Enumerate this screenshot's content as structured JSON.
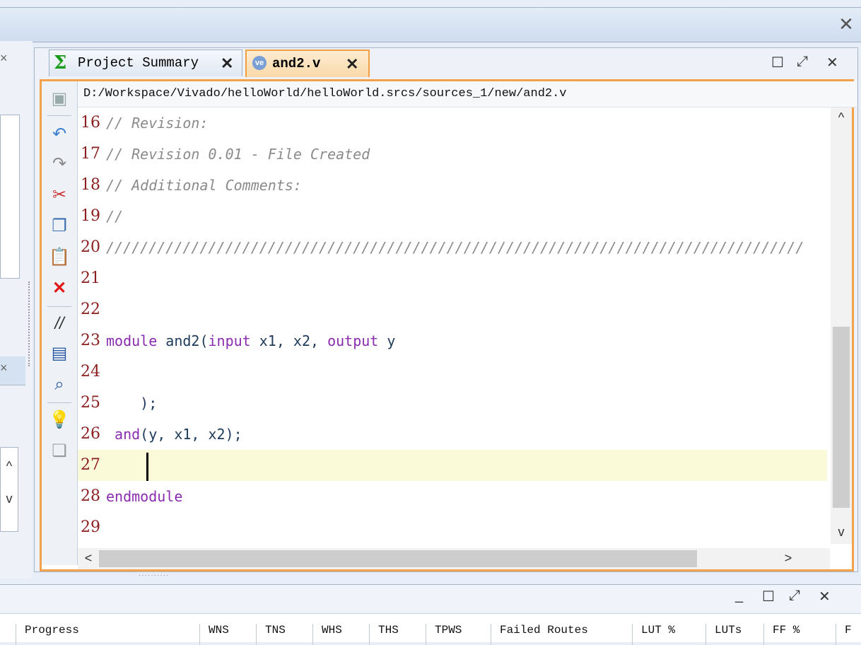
{
  "top_window": {
    "close_label": "✕"
  },
  "left_panels": {
    "close_label": "×",
    "scroll_up": "^",
    "scroll_down": "v"
  },
  "editor": {
    "tabs": [
      {
        "label": "Project Summary",
        "icon": "sigma-icon",
        "close_label": "✕"
      },
      {
        "label": "and2.v",
        "icon": "verilog-file-icon",
        "close_label": "✕",
        "active": true
      }
    ],
    "window_controls": {
      "maximize": "☐",
      "restore": "⤢",
      "close": "✕"
    },
    "file_path": "D:/Workspace/Vivado/helloWorld/helloWorld.srcs/sources_1/new/and2.v",
    "lines": [
      {
        "num": "16",
        "text": "// Revision:"
      },
      {
        "num": "17",
        "text": "// Revision 0.01 - File Created"
      },
      {
        "num": "18",
        "text": "// Additional Comments:"
      },
      {
        "num": "19",
        "text": "//"
      },
      {
        "num": "20",
        "text": "//////////////////////////////////////////////////////////////////////////////////"
      },
      {
        "num": "21",
        "text": ""
      },
      {
        "num": "22",
        "text": ""
      },
      {
        "num": "23",
        "p1": "module",
        "p2": " and2(",
        "p3": "input",
        "p4": " x1, x2, ",
        "p5": "output",
        "p6": " y"
      },
      {
        "num": "24",
        "text": ""
      },
      {
        "num": "25",
        "text": "    );"
      },
      {
        "num": "26",
        "p1": " and",
        "p2": "(y, x1, x2);"
      },
      {
        "num": "27",
        "text": ""
      },
      {
        "num": "28",
        "text": "endmodule"
      },
      {
        "num": "29",
        "text": ""
      }
    ],
    "scroll": {
      "up": "^",
      "down": "v",
      "left": "<",
      "right": ">"
    },
    "colors": {
      "accent": "#f4a24a",
      "comment": "#8a8a8a",
      "keyword": "#8a2caf",
      "line_number": "#8b1e1e",
      "current_line": "#fbfad8"
    }
  },
  "bottom_panel": {
    "controls": {
      "minimize": "_",
      "maximize": "☐",
      "restore": "⤢",
      "close": "✕"
    },
    "columns": [
      "Progress",
      "WNS",
      "TNS",
      "WHS",
      "THS",
      "TPWS",
      "Failed Routes",
      "LUT %",
      "LUTs",
      "FF %",
      "F"
    ]
  }
}
